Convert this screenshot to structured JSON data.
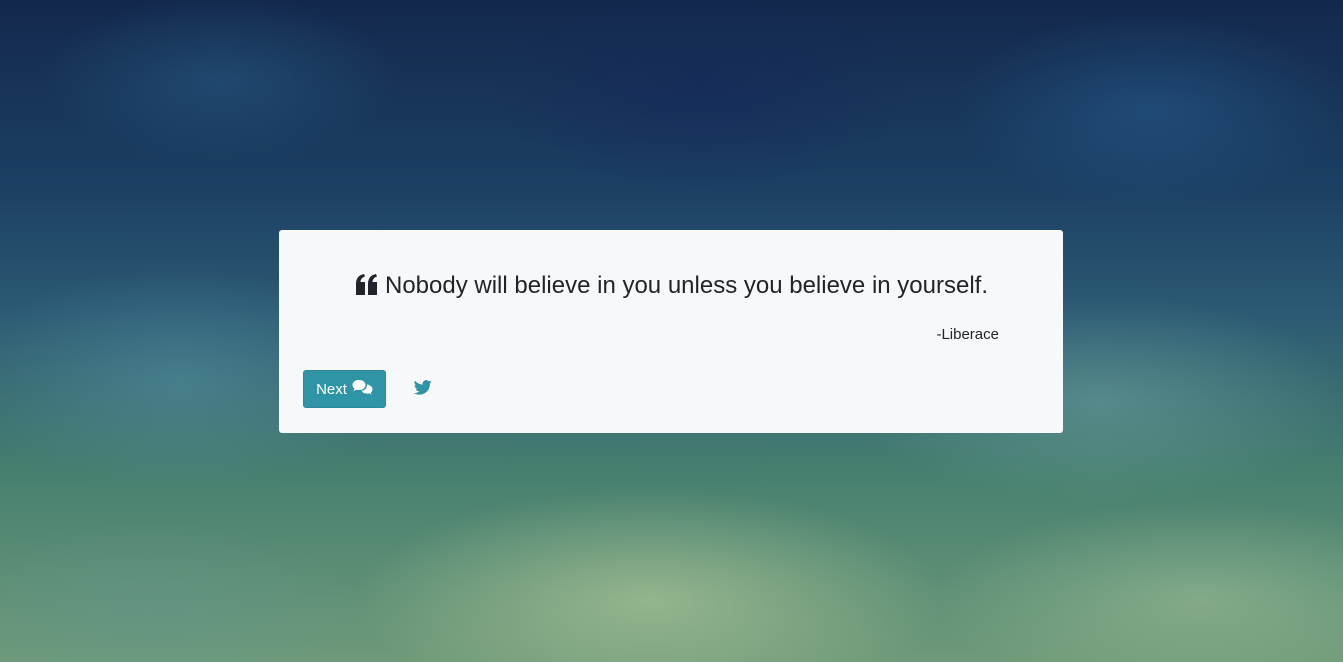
{
  "quote": {
    "text": "Nobody will believe in you unless you believe in yourself.",
    "author": "-Liberace"
  },
  "actions": {
    "next_label": "Next",
    "next_icon": "comments-icon",
    "share_icon": "twitter-icon"
  },
  "colors": {
    "card_background": "#f7f8fa",
    "button_background": "#2f95a6",
    "twitter_blue": "#2f95a6",
    "text": "#212529"
  }
}
